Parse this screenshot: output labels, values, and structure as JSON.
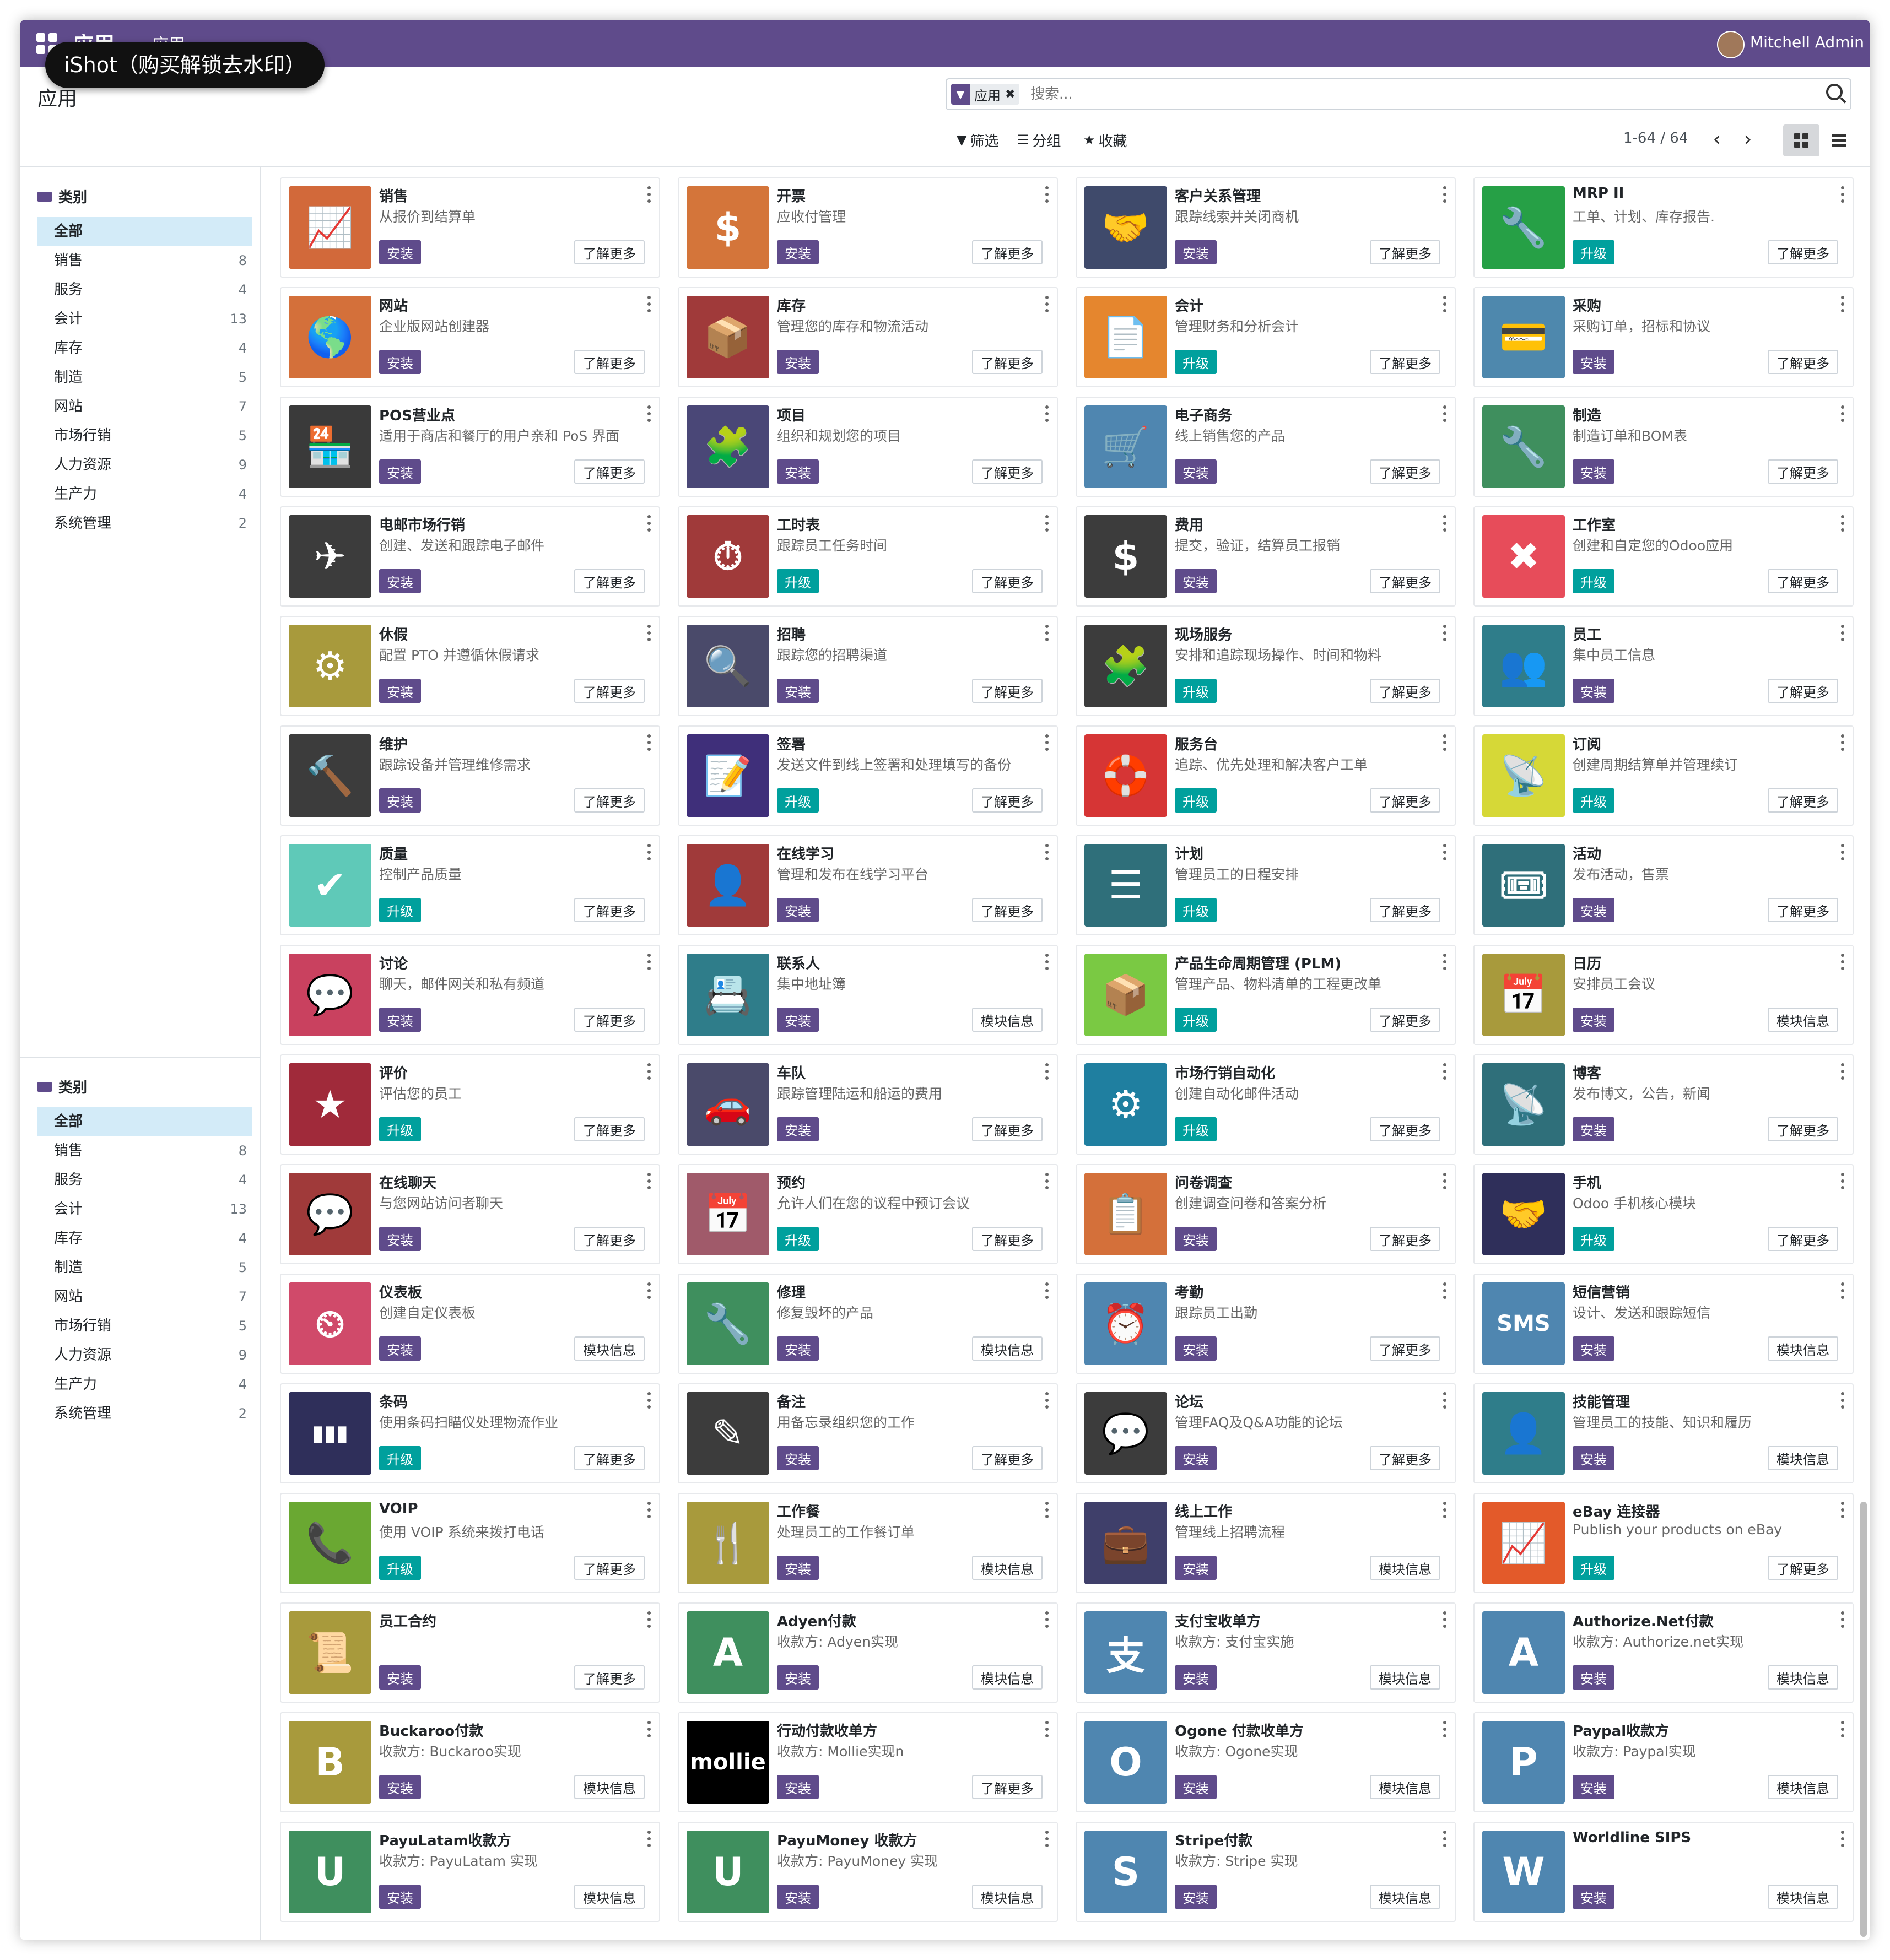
{
  "navbar": {
    "title": "应用",
    "crumb": "应用",
    "user_name": "Mitchell Admin"
  },
  "watermark": "iShot（购买解锁去水印）",
  "control_panel": {
    "page_title": "应用",
    "search_facet": "应用",
    "search_placeholder": "搜索...",
    "filter_label": "筛选",
    "group_label": "分组",
    "favorites_label": "收藏",
    "pager": "1-64 / 64"
  },
  "sidebar": {
    "header": "类别",
    "items": [
      {
        "label": "全部",
        "count": ""
      },
      {
        "label": "销售",
        "count": "8"
      },
      {
        "label": "服务",
        "count": "4"
      },
      {
        "label": "会计",
        "count": "13"
      },
      {
        "label": "库存",
        "count": "4"
      },
      {
        "label": "制造",
        "count": "5"
      },
      {
        "label": "网站",
        "count": "7"
      },
      {
        "label": "市场行销",
        "count": "5"
      },
      {
        "label": "人力资源",
        "count": "9"
      },
      {
        "label": "生产力",
        "count": "4"
      },
      {
        "label": "系统管理",
        "count": "2"
      }
    ]
  },
  "apps": [
    {
      "name": "销售",
      "summary": "从报价到结算单",
      "action": "安装",
      "more": "了解更多",
      "color": "#d2693a",
      "glyph": "📈"
    },
    {
      "name": "开票",
      "summary": "应收付管理",
      "action": "安装",
      "more": "了解更多",
      "color": "#d4753a",
      "glyph": "$"
    },
    {
      "name": "客户关系管理",
      "summary": "跟踪线索并关闭商机",
      "action": "安装",
      "more": "了解更多",
      "color": "#3f4a6b",
      "glyph": "🤝"
    },
    {
      "name": "MRP II",
      "summary": "工单、计划、库存报告.",
      "action": "升级",
      "more": "了解更多",
      "color": "#26a046",
      "glyph": "🔧"
    },
    {
      "name": "网站",
      "summary": "企业版网站创建器",
      "action": "安装",
      "more": "了解更多",
      "color": "#d4703a",
      "glyph": "🌎"
    },
    {
      "name": "库存",
      "summary": "管理您的库存和物流活动",
      "action": "安装",
      "more": "了解更多",
      "color": "#a03a3a",
      "glyph": "📦"
    },
    {
      "name": "会计",
      "summary": "管理财务和分析会计",
      "action": "升级",
      "more": "了解更多",
      "color": "#e5862e",
      "glyph": "📄"
    },
    {
      "name": "采购",
      "summary": "采购订单，招标和协议",
      "action": "安装",
      "more": "了解更多",
      "color": "#4e88ad",
      "glyph": "💳"
    },
    {
      "name": "POS营业点",
      "summary": "适用于商店和餐厅的用户亲和 PoS 界面",
      "action": "安装",
      "more": "了解更多",
      "color": "#3a3a3a",
      "glyph": "🏪"
    },
    {
      "name": "项目",
      "summary": "组织和规划您的项目",
      "action": "安装",
      "more": "了解更多",
      "color": "#4a4777",
      "glyph": "🧩"
    },
    {
      "name": "电子商务",
      "summary": "线上销售您的产品",
      "action": "安装",
      "more": "了解更多",
      "color": "#4f86b0",
      "glyph": "🛒"
    },
    {
      "name": "制造",
      "summary": "制造订单和BOM表",
      "action": "安装",
      "more": "了解更多",
      "color": "#3f8f5e",
      "glyph": "🔧"
    },
    {
      "name": "电邮市场行销",
      "summary": "创建、发送和跟踪电子邮件",
      "action": "安装",
      "more": "了解更多",
      "color": "#3c3c3c",
      "glyph": "✈"
    },
    {
      "name": "工时表",
      "summary": "跟踪员工任务时间",
      "action": "升级",
      "more": "了解更多",
      "color": "#a03a3a",
      "glyph": "⏱"
    },
    {
      "name": "费用",
      "summary": "提交，验证，结算员工报销",
      "action": "安装",
      "more": "了解更多",
      "color": "#3c3c3c",
      "glyph": "$"
    },
    {
      "name": "工作室",
      "summary": "创建和自定您的Odoo应用",
      "action": "升级",
      "more": "了解更多",
      "color": "#e74c5a",
      "glyph": "✖"
    },
    {
      "name": "休假",
      "summary": "配置 PTO 并遵循休假请求",
      "action": "安装",
      "more": "了解更多",
      "color": "#a89a3c",
      "glyph": "⚙"
    },
    {
      "name": "招聘",
      "summary": "跟踪您的招聘渠道",
      "action": "安装",
      "more": "了解更多",
      "color": "#4a4a6a",
      "glyph": "🔍"
    },
    {
      "name": "现场服务",
      "summary": "安排和追踪现场操作、时间和物料",
      "action": "升级",
      "more": "了解更多",
      "color": "#3c3c3c",
      "glyph": "🧩"
    },
    {
      "name": "员工",
      "summary": "集中员工信息",
      "action": "安装",
      "more": "了解更多",
      "color": "#2f7d8a",
      "glyph": "👥"
    },
    {
      "name": "维护",
      "summary": "跟踪设备并管理维修需求",
      "action": "安装",
      "more": "了解更多",
      "color": "#3c3c3c",
      "glyph": "🔨"
    },
    {
      "name": "签署",
      "summary": "发送文件到线上签署和处理填写的备份",
      "action": "升级",
      "more": "了解更多",
      "color": "#3f2f7a",
      "glyph": "📝"
    },
    {
      "name": "服务台",
      "summary": "追踪、优先处理和解决客户工单",
      "action": "升级",
      "more": "了解更多",
      "color": "#d63535",
      "glyph": "🛟"
    },
    {
      "name": "订阅",
      "summary": "创建周期结算单并管理续订",
      "action": "升级",
      "more": "了解更多",
      "color": "#d6d837",
      "glyph": "📡"
    },
    {
      "name": "质量",
      "summary": "控制产品质量",
      "action": "升级",
      "more": "了解更多",
      "color": "#5fc9b8",
      "glyph": "✔"
    },
    {
      "name": "在线学习",
      "summary": "管理和发布在线学习平台",
      "action": "安装",
      "more": "了解更多",
      "color": "#a03a3a",
      "glyph": "👤"
    },
    {
      "name": "计划",
      "summary": "管理员工的日程安排",
      "action": "升级",
      "more": "了解更多",
      "color": "#2f6f7a",
      "glyph": "☰"
    },
    {
      "name": "活动",
      "summary": "发布活动，售票",
      "action": "安装",
      "more": "了解更多",
      "color": "#2f6f7a",
      "glyph": "🎟"
    },
    {
      "name": "讨论",
      "summary": "聊天，邮件网关和私有频道",
      "action": "安装",
      "more": "了解更多",
      "color": "#c9415f",
      "glyph": "💬"
    },
    {
      "name": "联系人",
      "summary": "集中地址簿",
      "action": "安装",
      "more": "模块信息",
      "color": "#2f7d8a",
      "glyph": "📇"
    },
    {
      "name": "产品生命周期管理 (PLM)",
      "summary": "管理产品、物料清单的工程更改单",
      "action": "升级",
      "more": "了解更多",
      "color": "#7ac943",
      "glyph": "📦"
    },
    {
      "name": "日历",
      "summary": "安排员工会议",
      "action": "安装",
      "more": "模块信息",
      "color": "#a89a3c",
      "glyph": "📅"
    },
    {
      "name": "评价",
      "summary": "评估您的员工",
      "action": "升级",
      "more": "了解更多",
      "color": "#a02a3a",
      "glyph": "★"
    },
    {
      "name": "车队",
      "summary": "跟踪管理陆运和船运的费用",
      "action": "安装",
      "more": "了解更多",
      "color": "#4a4a6a",
      "glyph": "🚗"
    },
    {
      "name": "市场行销自动化",
      "summary": "创建自动化邮件活动",
      "action": "升级",
      "more": "了解更多",
      "color": "#1f7fa0",
      "glyph": "⚙"
    },
    {
      "name": "博客",
      "summary": "发布博文，公告，新闻",
      "action": "安装",
      "more": "了解更多",
      "color": "#2f6f7a",
      "glyph": "📡"
    },
    {
      "name": "在线聊天",
      "summary": "与您网站访问者聊天",
      "action": "安装",
      "more": "了解更多",
      "color": "#a03a3a",
      "glyph": "💬"
    },
    {
      "name": "预约",
      "summary": "允许人们在您的议程中预订会议",
      "action": "升级",
      "more": "了解更多",
      "color": "#a05a6a",
      "glyph": "📅"
    },
    {
      "name": "问卷调查",
      "summary": "创建调查问卷和答案分析",
      "action": "安装",
      "more": "了解更多",
      "color": "#d4703a",
      "glyph": "📋"
    },
    {
      "name": "手机",
      "summary": "Odoo 手机核心模块",
      "action": "升级",
      "more": "了解更多",
      "color": "#2f2f5a",
      "glyph": "🤝"
    },
    {
      "name": "仪表板",
      "summary": "创建自定仪表板",
      "action": "安装",
      "more": "模块信息",
      "color": "#d04a6a",
      "glyph": "⏲"
    },
    {
      "name": "修理",
      "summary": "修复毁坏的产品",
      "action": "安装",
      "more": "模块信息",
      "color": "#3f8f5e",
      "glyph": "🔧"
    },
    {
      "name": "考勤",
      "summary": "跟踪员工出勤",
      "action": "安装",
      "more": "了解更多",
      "color": "#4f86b0",
      "glyph": "⏰"
    },
    {
      "name": "短信营销",
      "summary": "设计、发送和跟踪短信",
      "action": "安装",
      "more": "模块信息",
      "color": "#4f86b0",
      "glyph": "SMS"
    },
    {
      "name": "条码",
      "summary": "使用条码扫瞄仪处理物流作业",
      "action": "升级",
      "more": "了解更多",
      "color": "#2f2f5a",
      "glyph": "▮▮▮"
    },
    {
      "name": "备注",
      "summary": "用备忘录组织您的工作",
      "action": "安装",
      "more": "了解更多",
      "color": "#3c3c3c",
      "glyph": "✎"
    },
    {
      "name": "论坛",
      "summary": "管理FAQ及Q&A功能的论坛",
      "action": "安装",
      "more": "了解更多",
      "color": "#3c3c3c",
      "glyph": "💬"
    },
    {
      "name": "技能管理",
      "summary": "管理员工的技能、知识和履历",
      "action": "安装",
      "more": "模块信息",
      "color": "#2f7d8a",
      "glyph": "👤"
    },
    {
      "name": "VOIP",
      "summary": "使用 VOIP 系统来拨打电话",
      "action": "升级",
      "more": "了解更多",
      "color": "#6aa832",
      "glyph": "📞"
    },
    {
      "name": "工作餐",
      "summary": "处理员工的工作餐订单",
      "action": "安装",
      "more": "模块信息",
      "color": "#a89a3c",
      "glyph": "🍴"
    },
    {
      "name": "线上工作",
      "summary": "管理线上招聘流程",
      "action": "安装",
      "more": "模块信息",
      "color": "#3f3f6a",
      "glyph": "💼"
    },
    {
      "name": "eBay 连接器",
      "summary": "Publish your products on eBay",
      "action": "升级",
      "more": "了解更多",
      "color": "#e35a2a",
      "glyph": "📈"
    },
    {
      "name": "员工合约",
      "summary": "",
      "action": "安装",
      "more": "了解更多",
      "color": "#a89a3c",
      "glyph": "📜"
    },
    {
      "name": "Adyen付款",
      "summary": "收款方: Adyen实现",
      "action": "安装",
      "more": "模块信息",
      "color": "#3f8f5e",
      "glyph": "A"
    },
    {
      "name": "支付宝收单方",
      "summary": "收款方: 支付宝实施",
      "action": "安装",
      "more": "模块信息",
      "color": "#4f86b0",
      "glyph": "支"
    },
    {
      "name": "Authorize.Net付款",
      "summary": "收款方: Authorize.net实现",
      "action": "安装",
      "more": "模块信息",
      "color": "#4f86b0",
      "glyph": "A"
    },
    {
      "name": "Buckaroo付款",
      "summary": "收款方: Buckaroo实现",
      "action": "安装",
      "more": "模块信息",
      "color": "#a89a3c",
      "glyph": "B"
    },
    {
      "name": "行动付款收单方",
      "summary": "收款方: Mollie实现n",
      "action": "安装",
      "more": "了解更多",
      "color": "#000000",
      "glyph": "mollie"
    },
    {
      "name": "Ogone 付款收单方",
      "summary": "收款方: Ogone实现",
      "action": "安装",
      "more": "模块信息",
      "color": "#4f86b0",
      "glyph": "O"
    },
    {
      "name": "Paypal收款方",
      "summary": "收款方: Paypal实现",
      "action": "安装",
      "more": "模块信息",
      "color": "#4f86b0",
      "glyph": "P"
    },
    {
      "name": "PayuLatam收款方",
      "summary": "收款方: PayuLatam 实现",
      "action": "安装",
      "more": "模块信息",
      "color": "#3f8f5e",
      "glyph": "U"
    },
    {
      "name": "PayuMoney 收款方",
      "summary": "收款方: PayuMoney 实现",
      "action": "安装",
      "more": "模块信息",
      "color": "#3f8f5e",
      "glyph": "U"
    },
    {
      "name": "Stripe付款",
      "summary": "收款方: Stripe 实现",
      "action": "安装",
      "more": "模块信息",
      "color": "#4f86b0",
      "glyph": "S"
    },
    {
      "name": "Worldline SIPS",
      "summary": "",
      "action": "安装",
      "more": "模块信息",
      "color": "#4f86b0",
      "glyph": "W"
    }
  ]
}
